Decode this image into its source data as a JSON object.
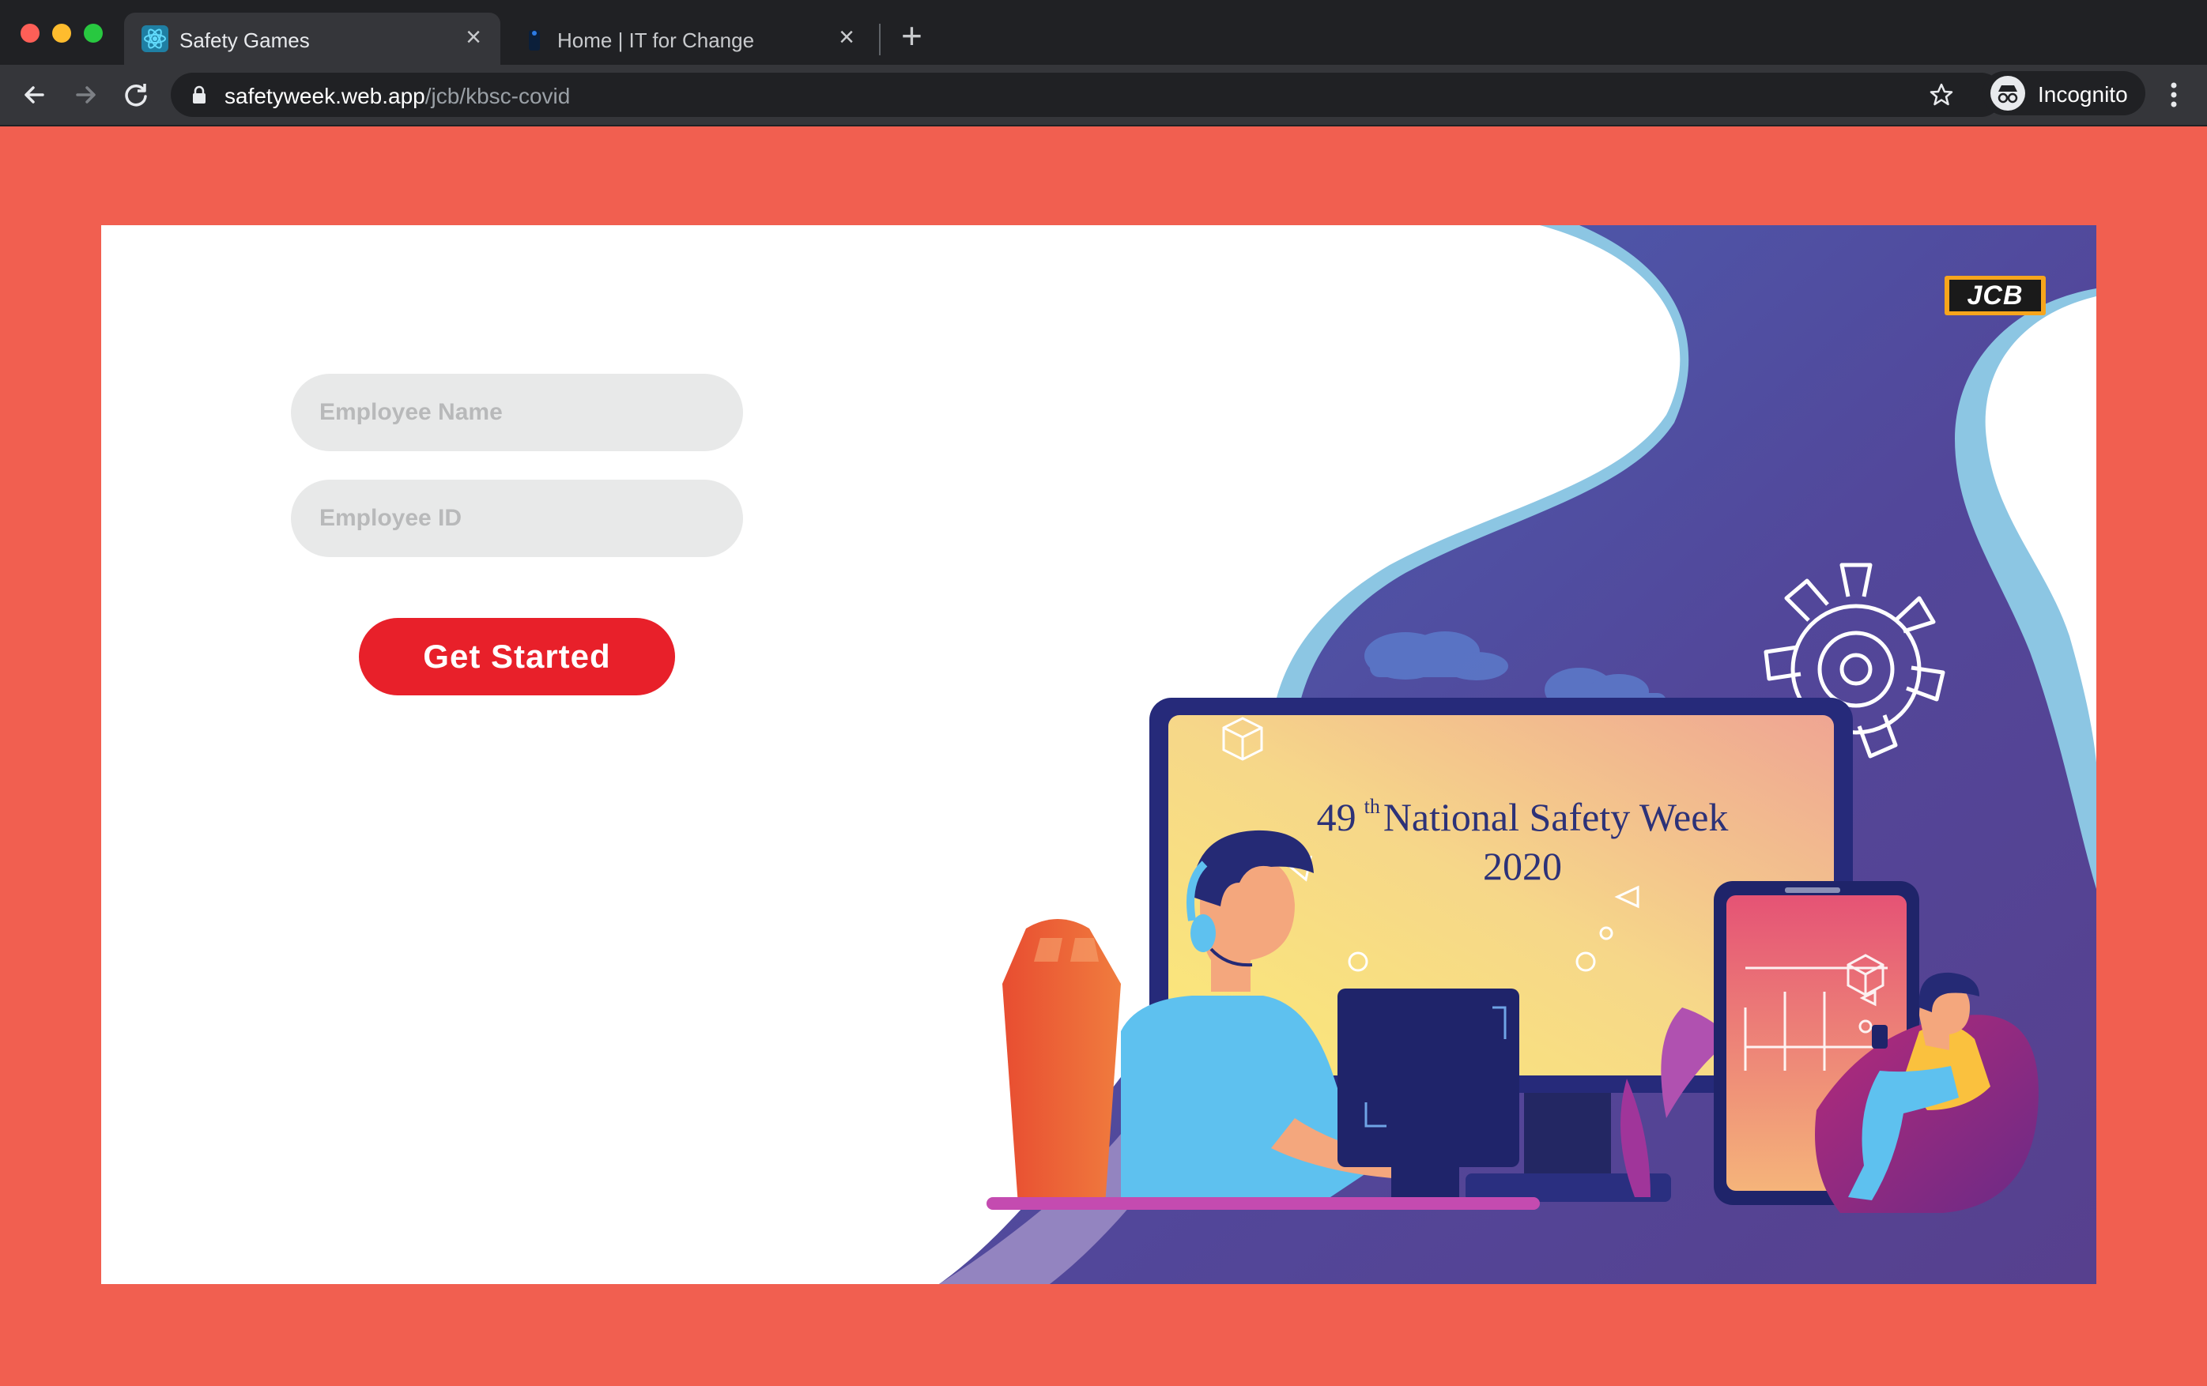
{
  "browser": {
    "tabs": [
      {
        "title": "Safety Games",
        "active": true,
        "icon": "react-atom-icon"
      },
      {
        "title": "Home | IT for Change",
        "active": false,
        "icon": "itfc-favicon"
      }
    ],
    "url": {
      "host": "safetyweek.web.app",
      "path": "/jcb/kbsc-covid"
    },
    "profile_label": "Incognito"
  },
  "form": {
    "name_placeholder": "Employee Name",
    "id_placeholder": "Employee ID",
    "submit_label": "Get Started"
  },
  "banner": {
    "brand_logo": "JCB",
    "edition": "49",
    "edition_suffix": "th",
    "event": "National Safety Week",
    "year": "2020"
  },
  "colors": {
    "page_background": "#f15f50",
    "button_red": "#e8202a",
    "field_gray": "#e8e9e9",
    "illustration_purple": "#4e4b9e"
  }
}
